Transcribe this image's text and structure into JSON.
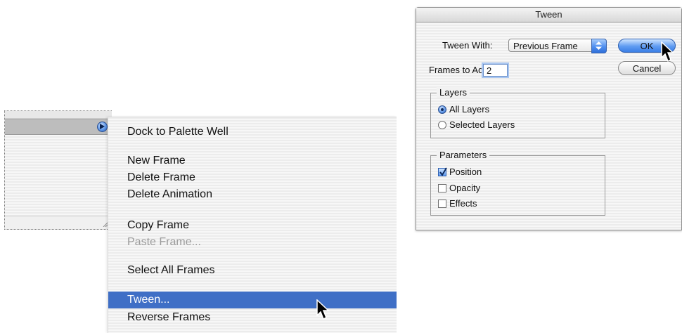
{
  "palette": {
    "menu_button_icon": "circle-arrow-icon",
    "resize_icon": "resize-grip-icon"
  },
  "context_menu": {
    "items": [
      {
        "label": "Dock to Palette Well",
        "state": "normal"
      },
      {
        "label": "New Frame",
        "state": "normal"
      },
      {
        "label": "Delete Frame",
        "state": "normal"
      },
      {
        "label": "Delete Animation",
        "state": "normal"
      },
      {
        "label": "Copy Frame",
        "state": "normal"
      },
      {
        "label": "Paste Frame...",
        "state": "disabled"
      },
      {
        "label": "Select All Frames",
        "state": "normal"
      },
      {
        "label": "Tween...",
        "state": "selected"
      },
      {
        "label": "Reverse Frames",
        "state": "normal"
      }
    ],
    "highlight_color": "#3f6fc6"
  },
  "dialog": {
    "title": "Tween",
    "tween_with_label": "Tween With:",
    "tween_with_value": "Previous Frame",
    "frames_to_add_label": "Frames to Add:",
    "frames_to_add_value": "2",
    "ok_label": "OK",
    "cancel_label": "Cancel",
    "layers_group": {
      "title": "Layers",
      "options": [
        {
          "label": "All Layers",
          "selected": true
        },
        {
          "label": "Selected Layers",
          "selected": false
        }
      ]
    },
    "parameters_group": {
      "title": "Parameters",
      "options": [
        {
          "label": "Position",
          "checked": true
        },
        {
          "label": "Opacity",
          "checked": false
        },
        {
          "label": "Effects",
          "checked": false
        }
      ]
    },
    "accent_color": "#5f9bf2"
  }
}
